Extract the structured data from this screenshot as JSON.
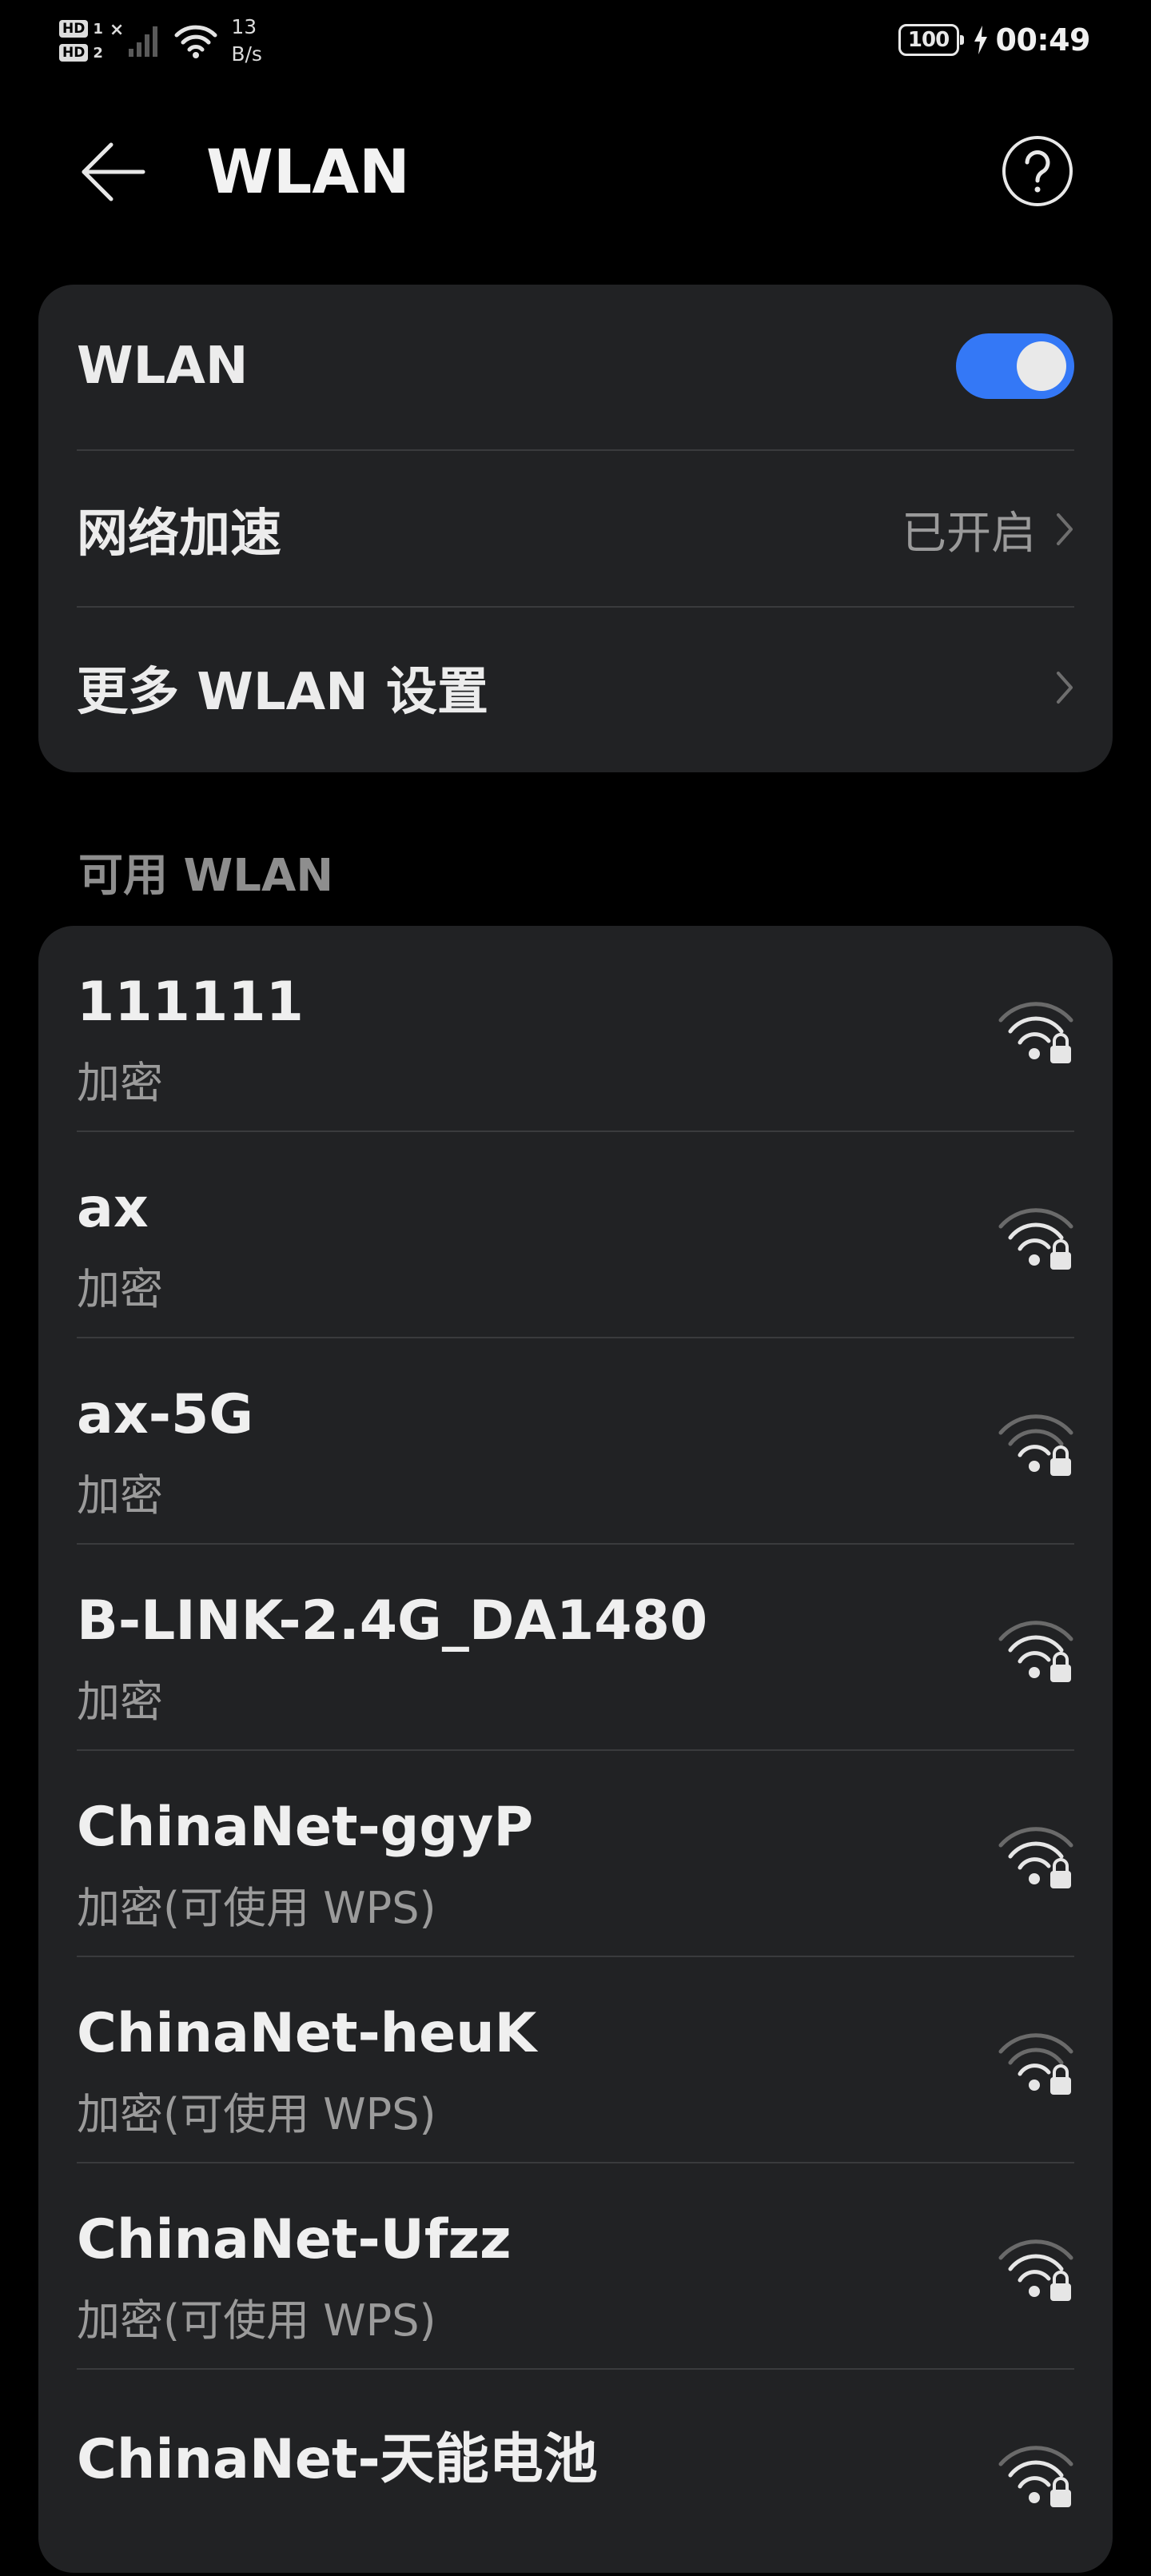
{
  "status_bar": {
    "sim1_badge": "HD",
    "sim1_num": "1",
    "sim2_badge": "HD",
    "sim2_num": "2",
    "no_signal": "×",
    "speed_value": "13",
    "speed_unit": "B/s",
    "battery_level": "100",
    "time": "00:49"
  },
  "app_bar": {
    "title": "WLAN"
  },
  "settings": {
    "wlan_label": "WLAN",
    "wlan_enabled": true,
    "accel_label": "网络加速",
    "accel_value": "已开启",
    "more_label": "更多 WLAN 设置"
  },
  "available": {
    "header": "可用 WLAN",
    "networks": [
      {
        "name": "111111",
        "security": "加密"
      },
      {
        "name": "ax",
        "security": "加密"
      },
      {
        "name": "ax-5G",
        "security": "加密"
      },
      {
        "name": "B-LINK-2.4G_DA1480",
        "security": "加密"
      },
      {
        "name": "ChinaNet-ggyP",
        "security": "加密(可使用 WPS)"
      },
      {
        "name": "ChinaNet-heuK",
        "security": "加密(可使用 WPS)"
      },
      {
        "name": "ChinaNet-Ufzz",
        "security": "加密(可使用 WPS)"
      },
      {
        "name": "ChinaNet-天能电池",
        "security": ""
      }
    ]
  },
  "colors": {
    "background": "#000000",
    "card": "#212224",
    "accent": "#3478f6"
  }
}
